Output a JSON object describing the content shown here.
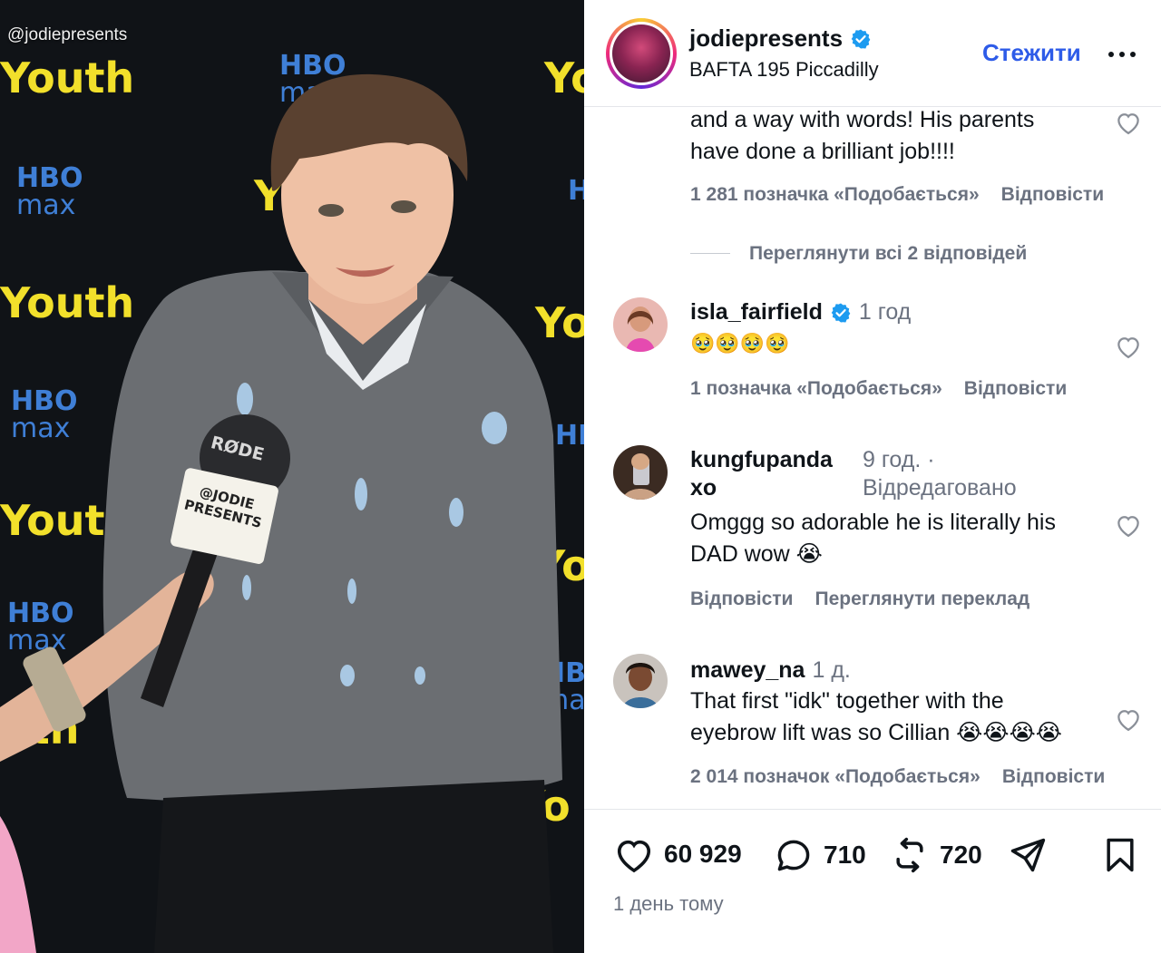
{
  "media": {
    "watermark": "@jodiepresents",
    "backdrop_logos": {
      "youth": "Youth",
      "hbo_top": "HBO",
      "hbo_bottom": "max"
    },
    "mic_brand": "RØDE",
    "mic_flag_text": "@JODIE PRESENTS"
  },
  "header": {
    "username": "jodiepresents",
    "location": "BAFTA 195 Piccadilly",
    "follow_label": "Стежити"
  },
  "comments": {
    "first": {
      "text_line1": "and a way with words! His parents",
      "text_line2": "have done a brilliant job!!!!",
      "likes": "1 281 позначка «Подобається»",
      "reply": "Відповісти",
      "view_replies": "Переглянути всі 2 відповідей"
    },
    "isla": {
      "username": "isla_fairfield",
      "time": "1 год",
      "text": "🥹🥹🥹🥹",
      "likes": "1 позначка «Подобається»",
      "reply": "Відповісти"
    },
    "kung": {
      "username_line1": "kungfupanda",
      "username_line2": "xo",
      "time": "9 год. ·",
      "edited": "Відредаговано",
      "text_line1": "Omggg so adorable he is literally his",
      "text_line2": "DAD wow 😭",
      "reply": "Відповісти",
      "translate": "Переглянути переклад"
    },
    "mawey": {
      "username": "mawey_na",
      "time": "1 д.",
      "text_line1": "That first \"idk\" together with the",
      "text_line2": "eyebrow lift was so Cillian 😭😭😭😭",
      "likes": "2 014 позначок «Подобається»",
      "reply": "Відповісти"
    }
  },
  "actions": {
    "likes_count": "60 929",
    "comments_count": "710",
    "reposts_count": "720",
    "posted_time": "1 день тому"
  },
  "colors": {
    "accent_blue": "#2d5be8",
    "verified_blue": "#1d9bf0",
    "muted_text": "#6b7280",
    "youth_yellow": "#f2e02b"
  }
}
